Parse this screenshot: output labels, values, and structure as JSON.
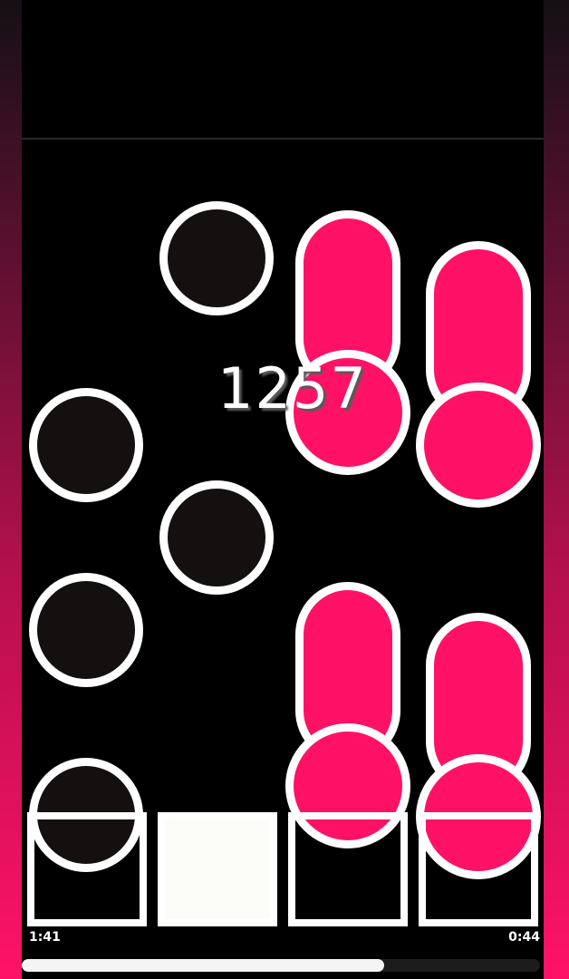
{
  "game": {
    "score": "1257",
    "elapsed_time": "1:41",
    "remaining_time": "0:44",
    "progress_fraction": 0.7,
    "accent_color": "#ff1266",
    "lanes": 4,
    "active_lane": 2
  }
}
